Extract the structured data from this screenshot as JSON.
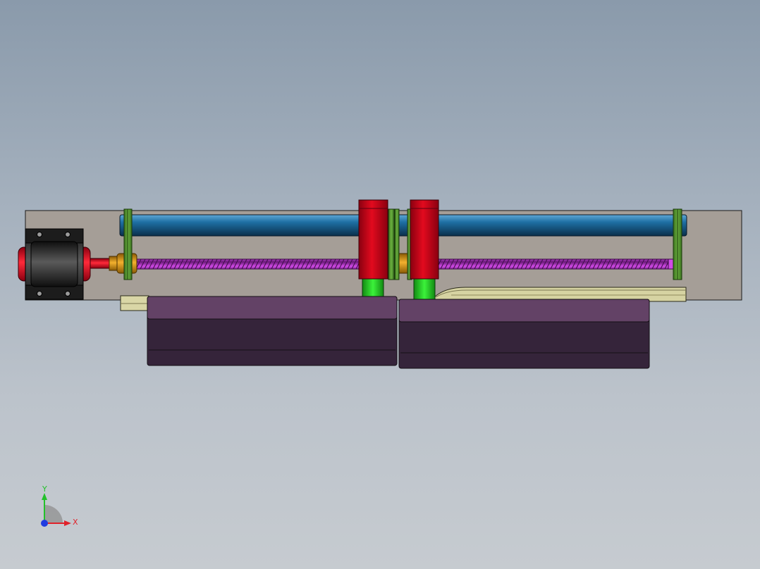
{
  "viewport": {
    "background_top": "#8a9aab",
    "background_bottom": "#c6cbd0"
  },
  "colors": {
    "base_plate": "#a59e97",
    "rod": "#1b5d8a",
    "lead_screw": "#b13ac6",
    "carriage": "#c8000e",
    "guide_block": "#24c81f",
    "end_plate": "#4d8f2b",
    "nut": "#e39a12",
    "motor_body": "#222222",
    "motor_cap": "#d8001a",
    "hopper": "#5f3d62",
    "rail": "#cfcc9c"
  },
  "triad": {
    "x_label": "X",
    "y_label": "Y",
    "x_color": "#e0222b",
    "y_color": "#22c12a",
    "z_color": "#1f3be0"
  }
}
